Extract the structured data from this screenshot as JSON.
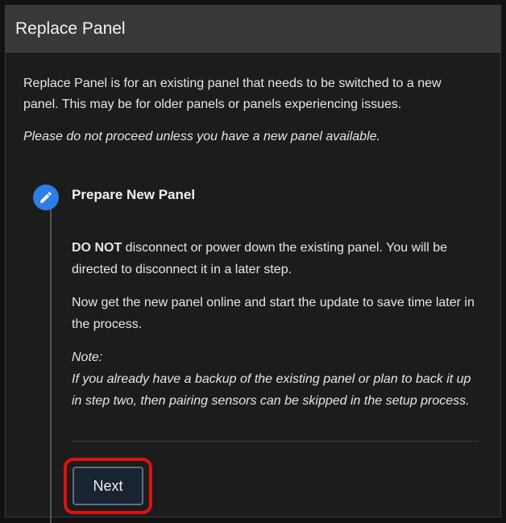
{
  "header": {
    "title": "Replace Panel"
  },
  "intro": {
    "description": "Replace Panel is for an existing panel that needs to be switched to a new panel. This may be for older panels or panels experiencing issues.",
    "warning": "Please do not proceed unless you have a new panel available."
  },
  "step": {
    "icon": "pencil-icon",
    "title": "Prepare New Panel",
    "paragraph1_strong": "DO NOT",
    "paragraph1_rest": " disconnect or power down the existing panel. You will be directed to disconnect it in a later step.",
    "paragraph2": "Now get the new panel online and start the update to save time later in the process.",
    "note_label": "Note:",
    "note_text": "If you already have a backup of the existing panel or plan to back it up in step two, then pairing sensors can be skipped in the setup process."
  },
  "actions": {
    "next_label": "Next"
  },
  "colors": {
    "accent": "#2d7ee8",
    "highlight": "#e01010",
    "header_bg": "#383838",
    "panel_bg": "#1c1c1c"
  }
}
